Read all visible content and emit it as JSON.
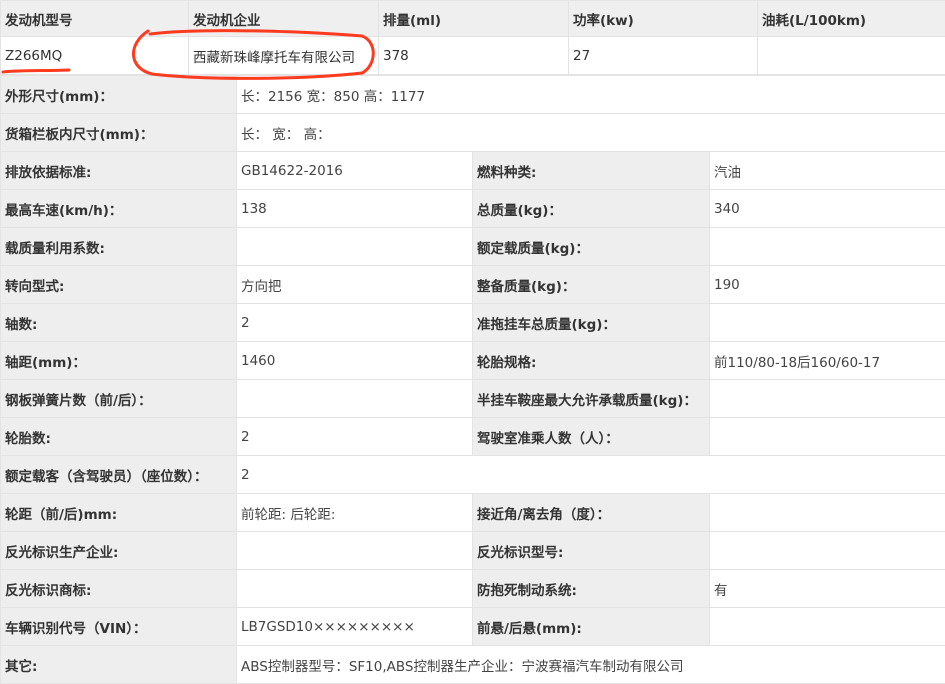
{
  "engine_table": {
    "headers": [
      "发动机型号",
      "发动机企业",
      "排量(ml)",
      "功率(kw)",
      "油耗(L/100km)"
    ],
    "row": {
      "model": "Z266MQ",
      "company": "西藏新珠峰摩托车有限公司",
      "displacement": "378",
      "power": "27",
      "fuel_consumption": ""
    }
  },
  "specs": {
    "dimensions": {
      "label": "外形尺寸(mm)：",
      "value": "长：2156 宽：850 高：1177"
    },
    "cargo_dimensions": {
      "label": "货箱栏板内尺寸(mm)：",
      "value": "长：  宽：  高："
    },
    "rows": [
      {
        "l1": "排放依据标准:",
        "v1": "GB14622-2016",
        "l2": "燃料种类:",
        "v2": "汽油"
      },
      {
        "l1": "最高车速(km/h)：",
        "v1": "138",
        "l2": "总质量(kg)：",
        "v2": "340"
      },
      {
        "l1": "载质量利用系数:",
        "v1": "",
        "l2": "额定载质量(kg)：",
        "v2": ""
      },
      {
        "l1": "转向型式:",
        "v1": "方向把",
        "l2": "整备质量(kg)：",
        "v2": "190"
      },
      {
        "l1": "轴数:",
        "v1": "2",
        "l2": "准拖挂车总质量(kg)：",
        "v2": ""
      },
      {
        "l1": "轴距(mm)：",
        "v1": "1460",
        "l2": "轮胎规格:",
        "v2": "前110/80-18后160/60-17"
      },
      {
        "l1": "钢板弹簧片数（前/后）：",
        "v1": "",
        "l2": "半挂车鞍座最大允许承载质量(kg)：",
        "v2": ""
      },
      {
        "l1": "轮胎数:",
        "v1": "2",
        "l2": "驾驶室准乘人数（人）：",
        "v2": ""
      }
    ],
    "seats": {
      "label": "额定载客（含驾驶员）（座位数）：",
      "value": "2"
    },
    "rows2": [
      {
        "l1": "轮距（前/后)mm:",
        "v1": "前轮距: 后轮距:",
        "l2": "接近角/离去角（度）：",
        "v2": ""
      },
      {
        "l1": "反光标识生产企业:",
        "v1": "",
        "l2": "反光标识型号:",
        "v2": ""
      },
      {
        "l1": "反光标识商标:",
        "v1": "",
        "l2": "防抱死制动系统:",
        "v2": "有"
      },
      {
        "l1": "车辆识别代号（VIN）：",
        "v1": "LB7GSD10×××××××××",
        "l2": "前悬/后悬(mm):",
        "v2": ""
      }
    ],
    "other": {
      "label": "其它:",
      "value": "ABS控制器型号：SF10,ABS控制器生产企业：宁波赛福汽车制动有限公司"
    }
  },
  "annotation": {
    "color": "#ff3b1f",
    "shapes": [
      "underline-model",
      "ellipse-company"
    ]
  }
}
